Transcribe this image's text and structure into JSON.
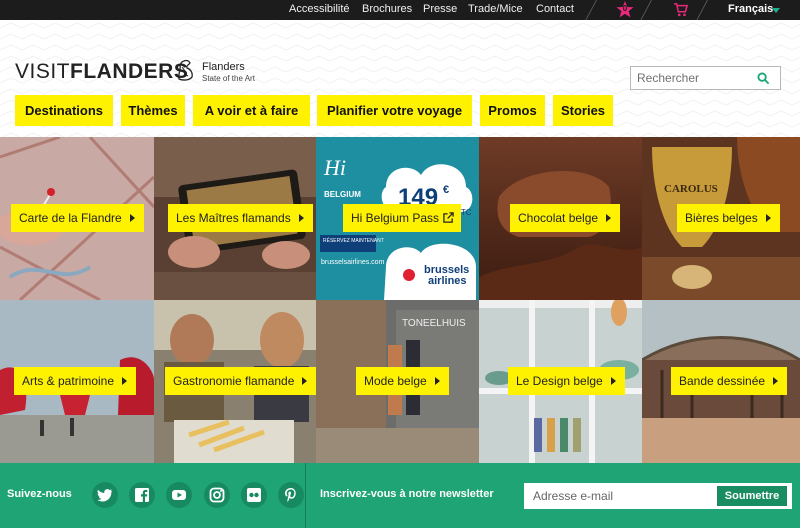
{
  "topbar": {
    "links": [
      "Accessibilité",
      "Brochures",
      "Presse",
      "Trade/Mice",
      "Contact"
    ],
    "favorites_count": "0",
    "language": "Français"
  },
  "header": {
    "logo_light": "VISIT",
    "logo_bold": "FLANDERS",
    "flanders_name": "Flanders",
    "flanders_sub": "State of the Art",
    "search_placeholder": "Rechercher"
  },
  "nav": [
    "Destinations",
    "Thèmes",
    "A voir et à faire",
    "Planifier votre voyage",
    "Promos",
    "Stories"
  ],
  "tiles": [
    {
      "label": "Carte de la Flandre",
      "icon": "map-pin"
    },
    {
      "label": "Les Maîtres flamands",
      "icon": "tablet-painting"
    },
    {
      "label": "Hi Belgium Pass",
      "icon": "external-link",
      "ad": {
        "hi": "Hi",
        "belgium": "BELGIUM",
        "price": "149",
        "currency": "€",
        "ttc": "TTC",
        "reserve": "RÉSERVEZ MAINTENANT",
        "url": "brusselsairlines.com",
        "brand1": "brussels",
        "brand2": "airlines"
      }
    },
    {
      "label": "Chocolat belge",
      "icon": "chocolate"
    },
    {
      "label": "Bières belges",
      "icon": "beer-glass",
      "glass_text": "CAROLUS"
    },
    {
      "label": "Arts & patrimoine",
      "icon": "sculptures"
    },
    {
      "label": "Gastronomie flamande",
      "icon": "fries"
    },
    {
      "label": "Mode belge",
      "icon": "street",
      "sign": "TONEELHUIS"
    },
    {
      "label": "Le Design belge",
      "icon": "vases"
    },
    {
      "label": "Bande dessinée",
      "icon": "arcade"
    }
  ],
  "footer": {
    "follow": "Suivez-nous",
    "socials": [
      "twitter-icon",
      "facebook-icon",
      "youtube-icon",
      "instagram-icon",
      "flickr-icon",
      "pinterest-icon"
    ],
    "newsletter_text": "Inscrivez-vous à notre newsletter",
    "email_placeholder": "Adresse e-mail",
    "submit_label": "Soumettre"
  },
  "colors": {
    "accent_yellow": "#fff200",
    "footer_green": "#1fa476",
    "topbar": "#1c1c1c"
  }
}
